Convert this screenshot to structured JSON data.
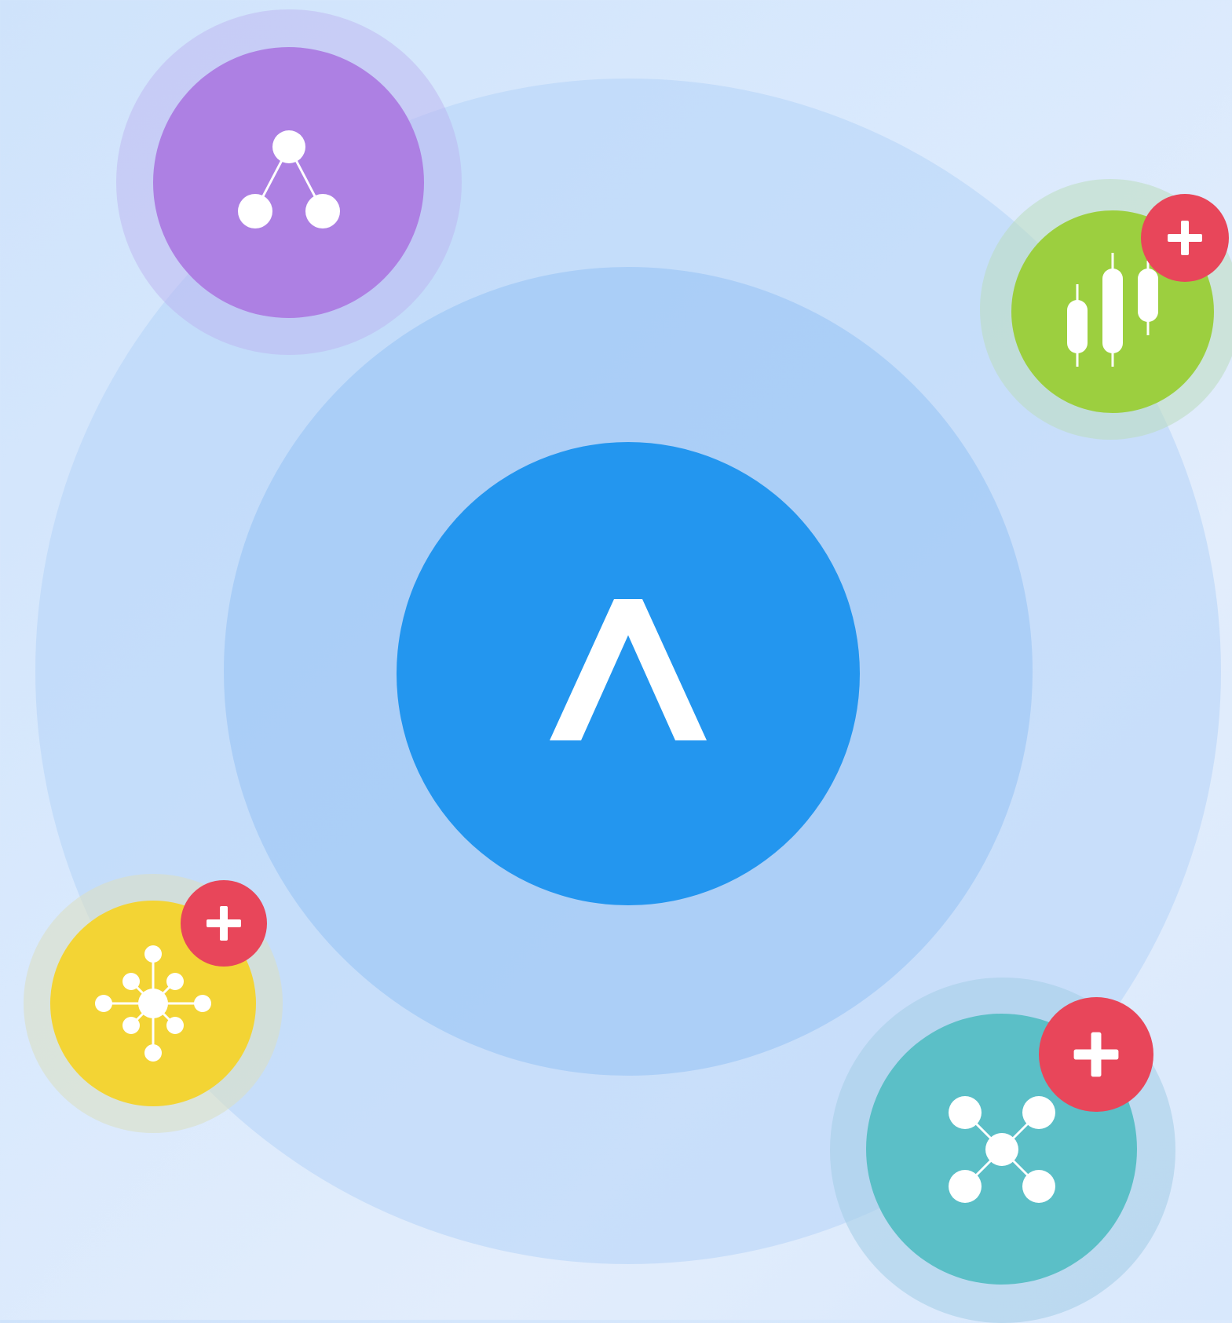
{
  "colors": {
    "background": "#d8e8fc",
    "outer_ring": "#c4dcf9",
    "inner_ring": "#a9cdf8",
    "core": "#2396ef",
    "purple": "#ad80e3",
    "green": "#9ccf3f",
    "yellow": "#f3d434",
    "teal": "#5bbfc7",
    "badge": "#e8465a",
    "icon": "#ffffff"
  },
  "center": {
    "icon": "caret-up-icon"
  },
  "nodes": [
    {
      "id": "purple",
      "icon": "tree-hierarchy-icon",
      "has_add_badge": false
    },
    {
      "id": "green",
      "icon": "candlestick-chart-icon",
      "has_add_badge": true
    },
    {
      "id": "yellow",
      "icon": "hub-network-icon",
      "has_add_badge": true
    },
    {
      "id": "teal",
      "icon": "star-network-icon",
      "has_add_badge": true
    }
  ],
  "badge": {
    "icon": "plus-icon"
  }
}
